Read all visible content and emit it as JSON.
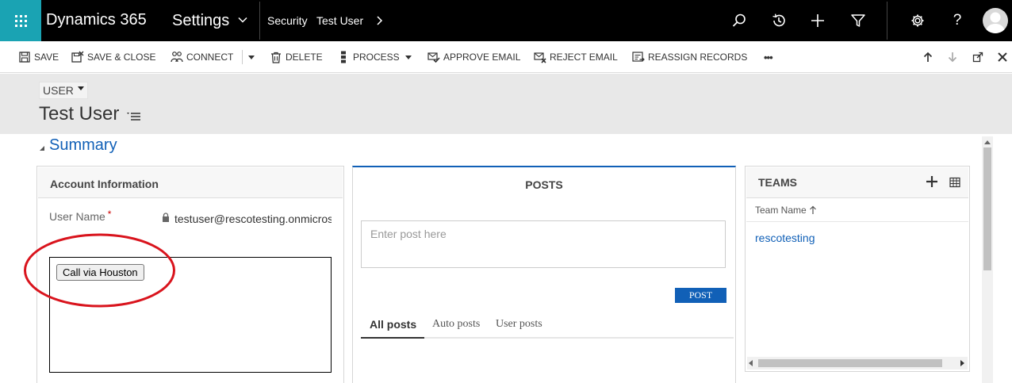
{
  "nav": {
    "app_name": "Dynamics 365",
    "area": "Settings",
    "breadcrumb": [
      "Security",
      "Test User"
    ],
    "icons": [
      "search-icon",
      "recent-icon",
      "add-icon",
      "filter-icon",
      "gear-icon",
      "help-icon",
      "avatar"
    ],
    "help_glyph": "?"
  },
  "toolbar": {
    "save": "SAVE",
    "save_close": "SAVE & CLOSE",
    "connect": "CONNECT",
    "delete": "DELETE",
    "process": "PROCESS",
    "approve_email": "APPROVE EMAIL",
    "reject_email": "REJECT EMAIL",
    "reassign_records": "REASSIGN RECORDS",
    "more": "•••"
  },
  "header": {
    "entity": "USER",
    "record_title": "Test User"
  },
  "summary": {
    "heading": "Summary"
  },
  "account": {
    "title": "Account Information",
    "user_name_label": "User Name",
    "required_mark": "*",
    "user_name_value": "testuser@rescotesting.onmicrosoft.com",
    "call_button": "Call via Houston"
  },
  "posts": {
    "title": "POSTS",
    "placeholder": "Enter post here",
    "post_button": "POST",
    "tabs": [
      "All posts",
      "Auto posts",
      "User posts"
    ]
  },
  "teams": {
    "title": "TEAMS",
    "column": "Team Name",
    "rows": [
      "rescotesting"
    ]
  },
  "colors": {
    "waffle": "#1aa3b3",
    "accent": "#1160b7",
    "annotation": "#d9141d"
  }
}
